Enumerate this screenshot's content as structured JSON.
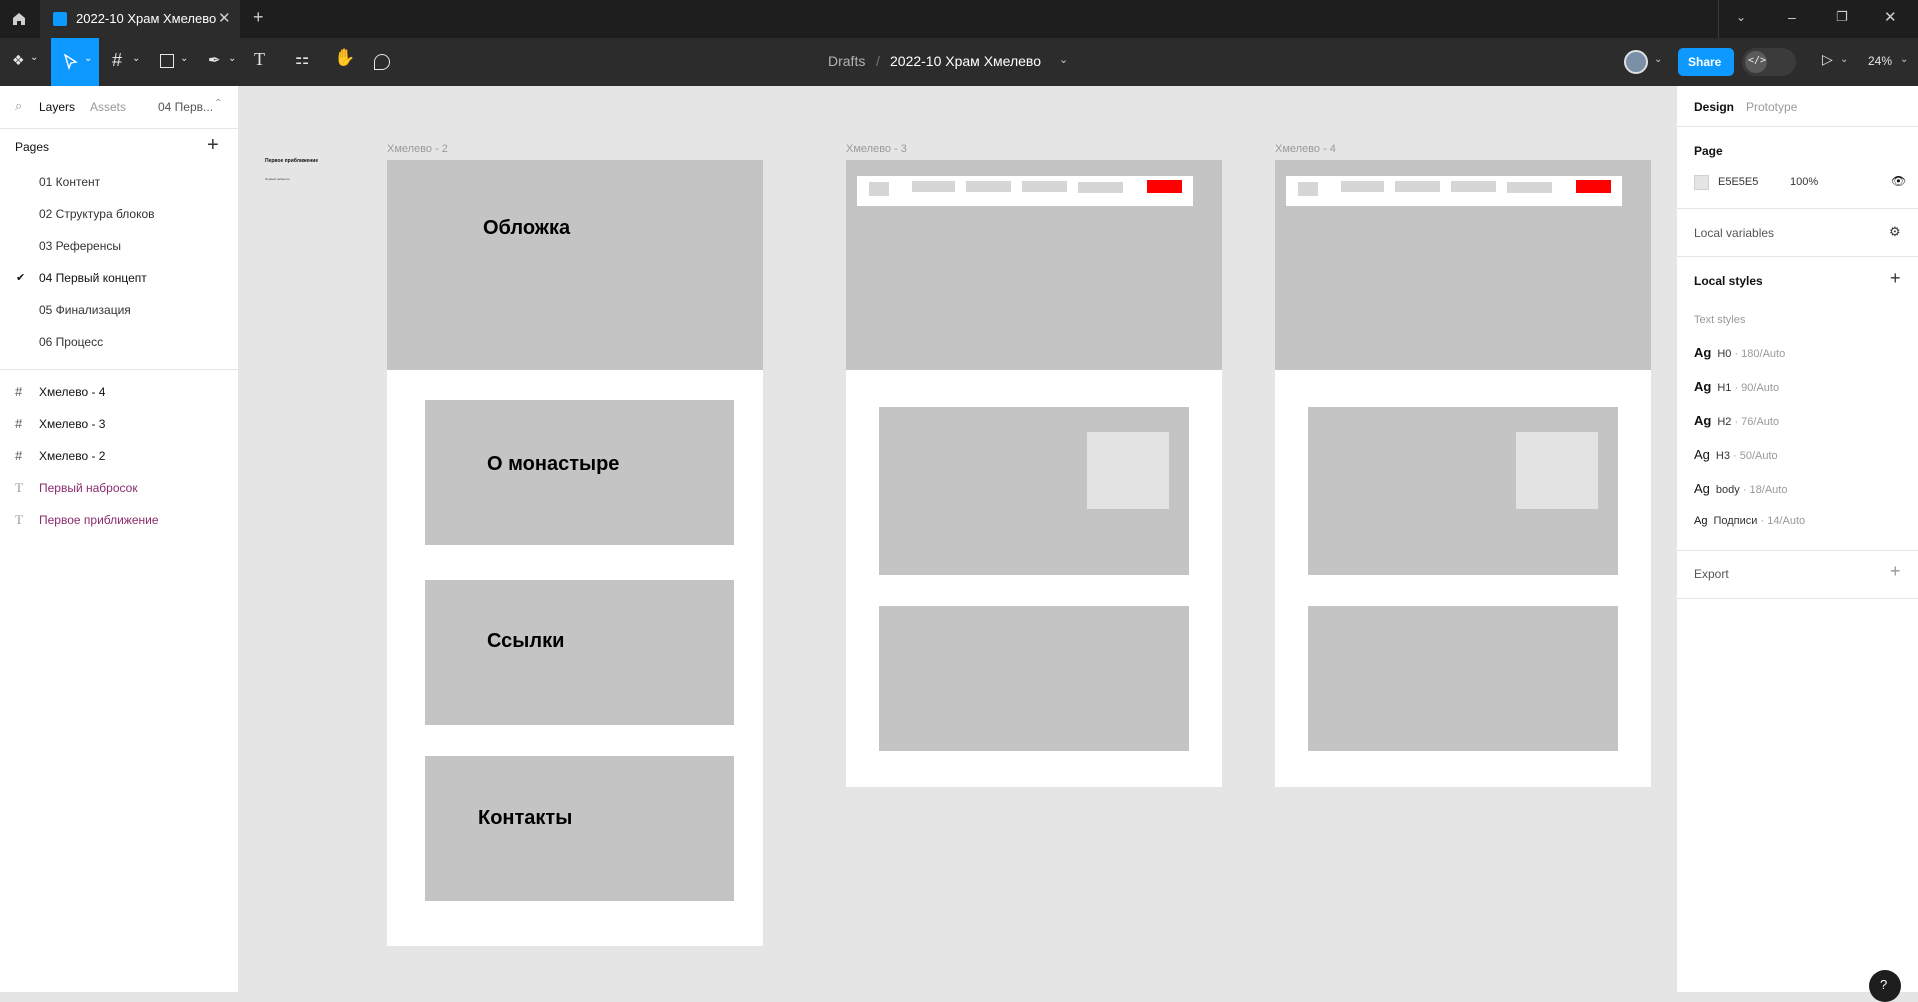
{
  "window": {
    "tab_title": "2022-10 Храм Хмелево"
  },
  "toolbar": {
    "breadcrumb_root": "Drafts",
    "breadcrumb_sep": "/",
    "file_name": "2022-10 Храм Хмелево",
    "share_label": "Share",
    "dev_mode_label": "</>",
    "zoom": "24%"
  },
  "left_panel": {
    "tabs": [
      "Layers",
      "Assets"
    ],
    "current_page_short": "04 Перв...",
    "pages_title": "Pages",
    "pages": [
      {
        "label": "01 Контент",
        "selected": false
      },
      {
        "label": "02 Структура блоков",
        "selected": false
      },
      {
        "label": "03 Референсы",
        "selected": false
      },
      {
        "label": "04 Первый концепт",
        "selected": true
      },
      {
        "label": "05 Финализация",
        "selected": false
      },
      {
        "label": "06 Процесс",
        "selected": false
      }
    ],
    "layers": [
      {
        "label": "Хмелево - 4",
        "type": "frame"
      },
      {
        "label": "Хмелево - 3",
        "type": "frame"
      },
      {
        "label": "Хмелево - 2",
        "type": "frame"
      },
      {
        "label": "Первый набросок",
        "type": "text"
      },
      {
        "label": "Первое приближение",
        "type": "text"
      }
    ]
  },
  "canvas": {
    "tiny_text_title": "Первое приближение",
    "tiny_text_sub": "Первый набросок",
    "frames": [
      {
        "label": "Хмелево - 2"
      },
      {
        "label": "Хмелево - 3"
      },
      {
        "label": "Хмелево - 4"
      }
    ],
    "blocks": {
      "cover": "Обложка",
      "about": "О монастыре",
      "links": "Ссылки",
      "contacts": "Контакты"
    }
  },
  "right_panel": {
    "tabs": [
      "Design",
      "Prototype"
    ],
    "page_title": "Page",
    "page_color": "E5E5E5",
    "page_opacity": "100%",
    "local_variables": "Local variables",
    "local_styles": "Local styles",
    "text_styles_title": "Text styles",
    "text_styles": [
      {
        "ag": "Ag",
        "name": "H0",
        "meta": " · 180/Auto"
      },
      {
        "ag": "Ag",
        "name": "H1",
        "meta": " · 90/Auto"
      },
      {
        "ag": "Ag",
        "name": "H2",
        "meta": " · 76/Auto"
      },
      {
        "ag": "Ag",
        "name": "H3",
        "meta": " · 50/Auto"
      },
      {
        "ag": "Ag",
        "name": "body",
        "meta": " · 18/Auto"
      },
      {
        "ag": "Ag",
        "name": "Подписи",
        "meta": " · 14/Auto"
      }
    ],
    "export": "Export",
    "help": "?"
  },
  "colors": {
    "accent": "#0d99ff",
    "red_button": "#ff0000",
    "placeholder_gray": "#c4c4c4",
    "canvas_bg": "#e5e5e5"
  }
}
